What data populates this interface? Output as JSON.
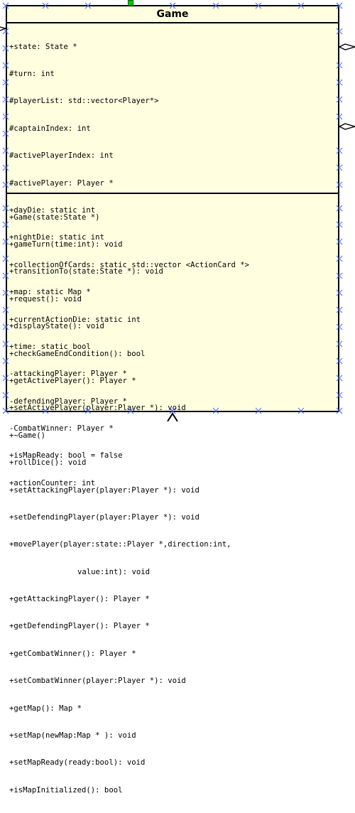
{
  "class": {
    "name": "Game",
    "attributes": [
      "+state: State *",
      "#turn: int",
      "#playerList: std::vector<Player*>",
      "#captainIndex: int",
      "#activePlayerIndex: int",
      "#activePlayer: Player *",
      "+dayDie: static int",
      "+nightDie: static int",
      "+collectionOfCards: static std::vector <ActionCard *>",
      "+map: static Map *",
      "+currentActionDie: static int",
      "+time: static bool",
      "-attackingPlayer: Player *",
      "-defendingPlayer: Player *",
      "-CombatWinner: Player *",
      "+isMapReady: bool = false",
      "+actionCounter: int"
    ],
    "methods": [
      "+Game(state:State *)",
      "+gameTurn(time:int): void",
      "+transitionTo(state:State *): void",
      "+request(): void",
      "+displayState(): void",
      "+checkGameEndCondition(): bool",
      "+getActivePlayer(): Player *",
      "+setActivePlayer(player:Player *): void",
      "+~Game()",
      "+rollDice(): void",
      "+setAttackingPlayer(player:Player *): void",
      "+setDefendingPlayer(player:Player *): void",
      "+movePlayer(player:state::Player *,direction:int,",
      "value:int): void",
      "+getAttackingPlayer(): Player *",
      "+getDefendingPlayer(): Player *",
      "+getCombatWinner(): Player *",
      "+setCombatWinner(player:Player *): void",
      "+getMap(): Map *",
      "+setMap(newMap:Map * ): void",
      "+setMapReady(ready:bool): void",
      "+isMapInitialized(): bool"
    ]
  },
  "colors": {
    "class_fill": "#ffffe0",
    "border": "#000000",
    "selection_handle": "#4a6cf7",
    "top_handle": "#00cc00"
  },
  "icons": {
    "left_arrow": "arrowhead-icon",
    "right_diamond_1": "aggregation-diamond-icon",
    "right_diamond_2": "aggregation-diamond-icon",
    "bottom_arrow": "inheritance-arrow-icon",
    "handles": "selection-handle-icon"
  }
}
